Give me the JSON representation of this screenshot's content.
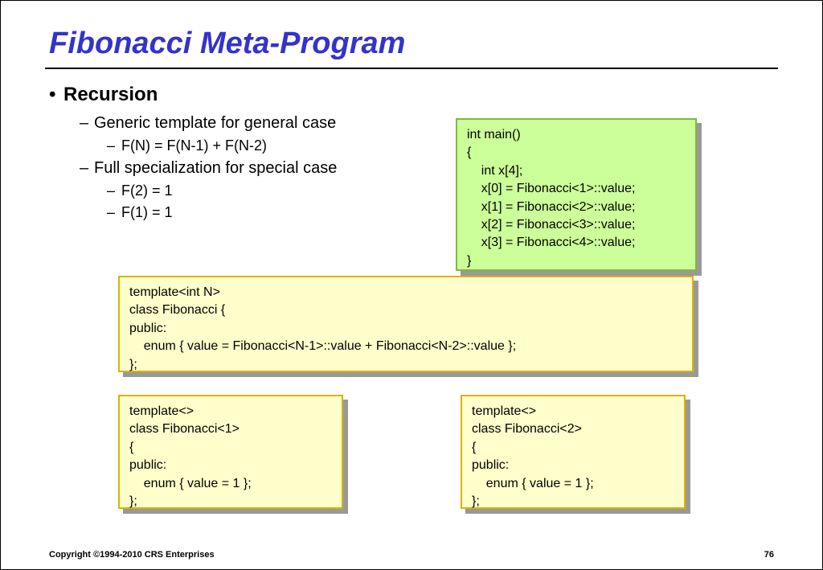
{
  "title": "Fibonacci Meta-Program",
  "bullets": {
    "lvl1": "Recursion",
    "lvl2a": "Generic template for general case",
    "lvl3a": "F(N) = F(N-1) + F(N-2)",
    "lvl2b": "Full specialization for special case",
    "lvl3b": "F(2) = 1",
    "lvl3c": "F(1) = 1"
  },
  "code": {
    "main": "int main()\n{\n    int x[4];\n    x[0] = Fibonacci<1>::value;\n    x[1] = Fibonacci<2>::value;\n    x[2] = Fibonacci<3>::value;\n    x[3] = Fibonacci<4>::value;\n}",
    "general": "template<int N>\nclass Fibonacci {\npublic:\n    enum { value = Fibonacci<N-1>::value + Fibonacci<N-2>::value };\n};",
    "spec1": "template<>\nclass Fibonacci<1>\n{\npublic:\n    enum { value = 1 };\n};",
    "spec2": "template<>\nclass Fibonacci<2>\n{\npublic:\n    enum { value = 1 };\n};"
  },
  "footer": {
    "copyright": "Copyright ©1994-2010 CRS Enterprises",
    "page": "76"
  }
}
